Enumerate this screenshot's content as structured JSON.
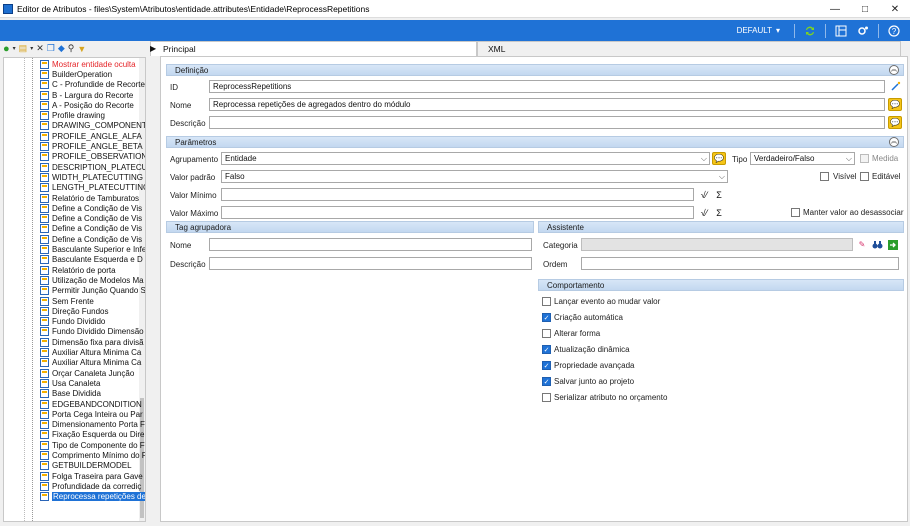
{
  "window": {
    "title": "Editor de Atributos - files\\System\\Atributos\\entidade.attributes\\Entidade\\ReprocessRepetitions"
  },
  "topbar": {
    "profile": "DEFAULT"
  },
  "tree": {
    "items": [
      {
        "label": "Mostrar entidade oculta",
        "style": "red"
      },
      {
        "label": "BuilderOperation"
      },
      {
        "label": "C - Profundide de Recorte"
      },
      {
        "label": "B - Largura do Recorte"
      },
      {
        "label": "A - Posição do Recorte"
      },
      {
        "label": "Profile drawing"
      },
      {
        "label": "DRAWING_COMPONENT"
      },
      {
        "label": "PROFILE_ANGLE_ALFA"
      },
      {
        "label": "PROFILE_ANGLE_BETA"
      },
      {
        "label": "PROFILE_OBSERVATION"
      },
      {
        "label": "DESCRIPTION_PLATECUT"
      },
      {
        "label": "WIDTH_PLATECUTTING"
      },
      {
        "label": "LENGTH_PLATECUTTING"
      },
      {
        "label": "Relatório de Tamburatos"
      },
      {
        "label": "Define a Condição de Vis"
      },
      {
        "label": "Define a Condição de Vis"
      },
      {
        "label": "Define a Condição de Vis"
      },
      {
        "label": "Define a Condição de Vis"
      },
      {
        "label": "Basculante Superior e Infe"
      },
      {
        "label": "Basculante Esquerda e D"
      },
      {
        "label": "Relatório de porta"
      },
      {
        "label": "Utilização de Modelos Ma"
      },
      {
        "label": "Permitir Junção Quando S"
      },
      {
        "label": "Sem Frente"
      },
      {
        "label": "Direção Fundos"
      },
      {
        "label": "Fundo Dividido"
      },
      {
        "label": "Fundo Dividido Dimensão"
      },
      {
        "label": "Dimensão fixa para divisã"
      },
      {
        "label": "Auxiliar Altura Minima Ca"
      },
      {
        "label": "Auxiliar Altura Minima Ca"
      },
      {
        "label": "Orçar Canaleta Junção"
      },
      {
        "label": "Usa Canaleta"
      },
      {
        "label": "Base Dividida"
      },
      {
        "label": "EDGEBANDCONDITION"
      },
      {
        "label": "Porta Cega Inteira ou Par"
      },
      {
        "label": "Dimensionamento Porta F"
      },
      {
        "label": "Fixação Esquerda ou Dire"
      },
      {
        "label": "Tipo de Componente do F"
      },
      {
        "label": "Comprimento Mínimo do F"
      },
      {
        "label": "GETBUILDERMODEL"
      },
      {
        "label": "Folga Traseira para Gave"
      },
      {
        "label": "Profundidade da corrediç"
      },
      {
        "label": "Reprocessa repetições de",
        "style": "sel"
      }
    ]
  },
  "tabs": {
    "principal": "Principal",
    "xml": "XML"
  },
  "definicao": {
    "header": "Definição",
    "id_label": "ID",
    "id_value": "ReprocessRepetitions",
    "nome_label": "Nome",
    "nome_value": "Reprocessa repetições de agregados dentro do módulo",
    "descricao_label": "Descrição",
    "descricao_value": ""
  },
  "parametros": {
    "header": "Parâmetros",
    "agrupamento_label": "Agrupamento",
    "agrupamento_value": "Entidade",
    "tipo_label": "Tipo",
    "tipo_value": "Verdadeiro/Falso",
    "medida_label": "Medida",
    "medida_checked": false,
    "valor_padrao_label": "Valor padrão",
    "valor_padrao_value": "Falso",
    "visivel_label": "Visível",
    "visivel_checked": false,
    "editavel_label": "Editável",
    "editavel_checked": false,
    "valor_minimo_label": "Valor Mínimo",
    "valor_minimo_value": "",
    "valor_maximo_label": "Valor Máximo",
    "valor_maximo_value": "",
    "manter_label": "Manter valor ao desassociar",
    "manter_checked": false
  },
  "tag": {
    "header": "Tag agrupadora",
    "nome_label": "Nome",
    "nome_value": "",
    "descricao_label": "Descrição",
    "descricao_value": ""
  },
  "assistente": {
    "header": "Assistente",
    "categoria_label": "Categoria",
    "categoria_value": "",
    "ordem_label": "Ordem",
    "ordem_value": ""
  },
  "comportamento": {
    "header": "Comportamento",
    "items": [
      {
        "label": "Lançar evento ao mudar valor",
        "checked": false
      },
      {
        "label": "Criação automática",
        "checked": true
      },
      {
        "label": "Alterar forma",
        "checked": false
      },
      {
        "label": "Atualização dinâmica",
        "checked": true
      },
      {
        "label": "Propriedade avançada",
        "checked": true
      },
      {
        "label": "Salvar junto ao projeto",
        "checked": true
      },
      {
        "label": "Serializar atributo no orçamento",
        "checked": false
      }
    ]
  },
  "icons": [
    "app-icon",
    "minimize-icon",
    "maximize-icon",
    "close-icon",
    "refresh-icon",
    "layout-icon",
    "settings-icon",
    "help-icon",
    "add-icon",
    "folder-icon",
    "delete-icon",
    "copy-icon",
    "move-icon",
    "find-icon",
    "filter-icon",
    "speech-icon",
    "eraser-icon",
    "binoculars-icon",
    "go-icon",
    "collapse-icon",
    "sqrt-icon",
    "sigma-icon",
    "red-arrow-annotation"
  ],
  "colors": {
    "accent": "#1f72d6",
    "section": "#c9dcf2",
    "tree_red": "#e5262a",
    "annotation": "#e3101a"
  }
}
